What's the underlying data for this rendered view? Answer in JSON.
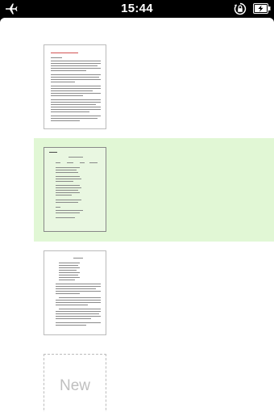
{
  "status_bar": {
    "time": "15:44",
    "icons": [
      "airplane-icon",
      "rotation-lock-icon",
      "battery-charging-icon"
    ]
  },
  "pages": [
    {
      "name": "page-1",
      "selected": false
    },
    {
      "name": "page-2",
      "selected": true
    },
    {
      "name": "page-3",
      "selected": false
    }
  ],
  "new_page": {
    "label": "New"
  },
  "colors": {
    "selected_band": "#e1f7d5",
    "page_border": "#bbbbbb",
    "new_label": "#bfbfbf"
  }
}
